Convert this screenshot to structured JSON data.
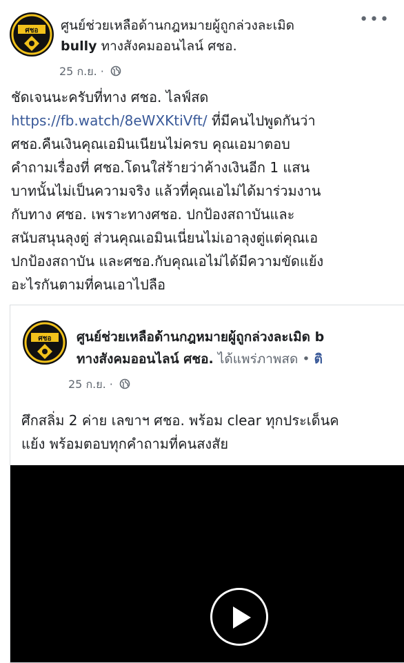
{
  "post": {
    "page_name": "ศูนย์ช่วยเหลือด้านกฎหมายผู้ถูกล่วงละเมิด",
    "page_name_line2_bold": "bully",
    "page_name_line2_rest": " ทางสังคมออนไลน์ ศชอ.",
    "date": "25 ก.ย.",
    "dot": "·",
    "more_glyph": "•••",
    "text_line1": "ชัดเจนนะครับที่ทาง ศชอ. ไลฟ์สด",
    "link": "https://fb.watch/8eWXKtiVft/",
    "text_after_link": " ที่มีคนไปพูดกันว่า",
    "text_lines": [
      "ศชอ.คืนเงินคุณเอมินเนียนไม่ครบ คุณเอมาตอบ",
      "คำถามเรื่องที่ ศชอ.โดนใส่ร้ายว่าค้างเงินอีก 1 แสน",
      "บาทนั้นไม่เป็นความจริง แล้วที่คุณเอไม่ได้มาร่วมงาน",
      "กับทาง ศชอ. เพราะทางศชอ. ปกป้องสถาบันและ",
      "สนับสนุนลุงตู่ ส่วนคุณเอมินเนี่ยนไม่เอาลุงตู่แต่คุณเอ",
      "ปกป้องสถาบัน และศชอ.กับคุณเอไม่ได้มีความขัดแย้ง",
      "อะไรกันตามที่คนเอาไปลือ"
    ],
    "avatar_label": "ศชอ"
  },
  "shared": {
    "page_name_line1": "ศูนย์ช่วยเหลือด้านกฎหมายผู้ถูกล่วงละเมิด b",
    "page_name_line2_bold": "ทางสังคมออนไลน์ ศชอ.",
    "live_text": " ได้แพร่ภาพสด",
    "follow_dot": " • ",
    "follow_partial": "ติ",
    "date": "25 ก.ย.",
    "dot": "·",
    "text_line1": "ศึกสลิ่ม 2 ค่าย เลขาฯ ศชอ. พร้อม clear ทุกประเด็นค",
    "text_line2": "แย้ง พร้อมตอบทุกคำถามที่คนสงสัย",
    "avatar_label": "ศชอ"
  },
  "colors": {
    "link": "#385898",
    "meta": "#606770",
    "badge": "#f2c21b"
  }
}
